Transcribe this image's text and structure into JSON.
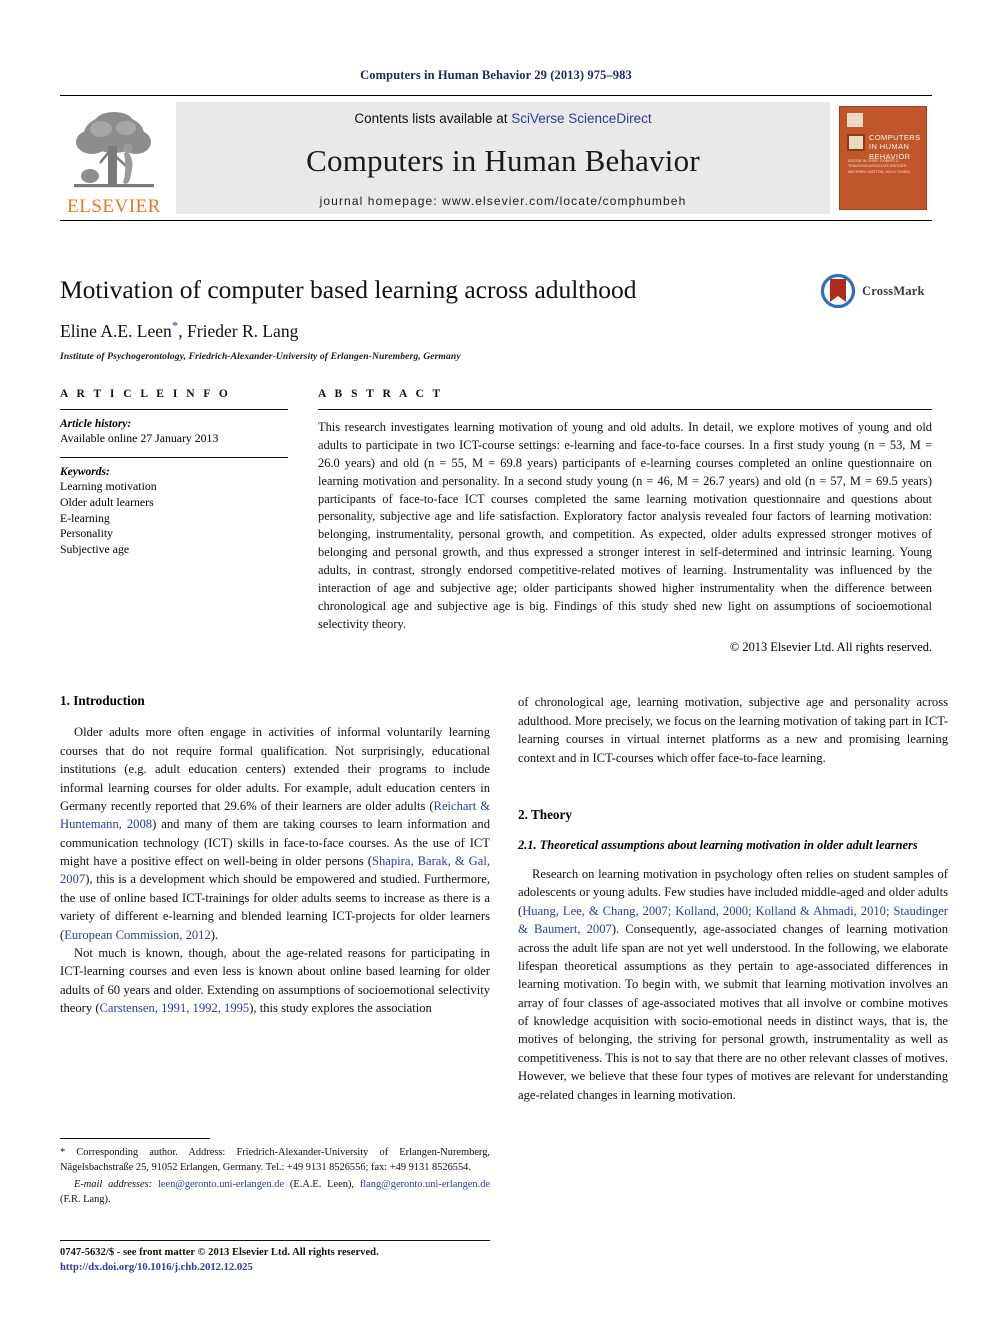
{
  "running_head": "Computers in Human Behavior 29 (2013) 975–983",
  "banner": {
    "contents_prefix": "Contents lists available at ",
    "contents_link": "SciVerse ScienceDirect",
    "journal_title": "Computers in Human Behavior",
    "homepage": "journal homepage: www.elsevier.com/locate/comphumbeh",
    "publisher_wordmark": "ELSEVIER",
    "cover_title": "COMPUTERS IN HUMAN BEHAVIOR",
    "cover_subtitle": "EDITOR-IN-CHIEF: ROBERT D. TENNYSON   ASSOCIATE EDITORS   MATTHIEU GUITTON, HOLLY O'NEILL"
  },
  "title": "Motivation of computer based learning across adulthood",
  "authors": "Eline A.E. Leen",
  "authors_rest": ", Frieder R. Lang",
  "corresponding_marker": "*",
  "affiliation": "Institute of Psychogerontology, Friedrich-Alexander-University of Erlangen-Nuremberg, Germany",
  "crossmark_label": "CrossMark",
  "article_info": {
    "heading": "A R T I C L E   I N F O",
    "history_heading": "Article history:",
    "history_line": "Available online 27 January 2013",
    "keywords_heading": "Keywords:",
    "keywords": [
      "Learning motivation",
      "Older adult learners",
      "E-learning",
      "Personality",
      "Subjective age"
    ]
  },
  "abstract": {
    "heading": "A B S T R A C T",
    "text": "This research investigates learning motivation of young and old adults. In detail, we explore motives of young and old adults to participate in two ICT-course settings: e-learning and face-to-face courses. In a first study young (n = 53, M = 26.0 years) and old (n = 55, M = 69.8 years) participants of e-learning courses completed an online questionnaire on learning motivation and personality. In a second study young (n = 46, M = 26.7 years) and old (n = 57, M = 69.5 years) participants of face-to-face ICT courses completed the same learning motivation questionnaire and questions about personality, subjective age and life satisfaction. Exploratory factor analysis revealed four factors of learning motivation: belonging, instrumentality, personal growth, and competition. As expected, older adults expressed stronger motives of belonging and personal growth, and thus expressed a stronger interest in self-determined and intrinsic learning. Young adults, in contrast, strongly endorsed competitive-related motives of learning. Instrumentality was influenced by the interaction of age and subjective age; older participants showed higher instrumentality when the difference between chronological age and subjective age is big. Findings of this study shed new light on assumptions of socioemotional selectivity theory.",
    "copyright": "© 2013 Elsevier Ltd. All rights reserved."
  },
  "sections": {
    "intro_heading": "1. Introduction",
    "intro_p1_a": "Older adults more often engage in activities of informal voluntarily learning courses that do not require formal qualification. Not surprisingly, educational institutions (e.g. adult education centers) extended their programs to include informal learning courses for older adults. For example, adult education centers in Germany recently reported that 29.6% of their learners are older adults (",
    "intro_p1_cit1": "Reichart & Huntemann, 2008",
    "intro_p1_b": ") and many of them are taking courses to learn information and communication technology (ICT) skills in face-to-face courses. As the use of ICT might have a positive effect on well-being in older persons (",
    "intro_p1_cit2": "Shapira, Barak, & Gal, 2007",
    "intro_p1_c": "), this is a development which should be empowered and studied. Furthermore, the use of online based ICT-trainings for older adults seems to increase as there is a variety of different e-learning and blended learning ICT-projects for older learners (",
    "intro_p1_cit3": "European Commission, 2012",
    "intro_p1_d": ").",
    "intro_p2_a": "Not much is known, though, about the age-related reasons for participating in ICT-learning courses and even less is known about online based learning for older adults of 60 years and older. Extending on assumptions of socioemotional selectivity theory (",
    "intro_p2_cit1": "Carstensen, 1991, 1992, 1995",
    "intro_p2_b": "), this study explores the association of chronological age, learning motivation, subjective age and personality across adulthood. More precisely, we focus on the learning motivation of taking part in ICT-learning courses in virtual internet platforms as a new and promising learning context and in ICT-courses which offer face-to-face learning.",
    "theory_heading": "2. Theory",
    "theory_sub_heading": "2.1. Theoretical assumptions about learning motivation in older adult learners",
    "theory_p1_a": "Research on learning motivation in psychology often relies on student samples of adolescents or young adults. Few studies have included middle-aged and older adults (",
    "theory_p1_cit": "Huang, Lee, & Chang, 2007; Kolland, 2000; Kolland & Ahmadi, 2010; Staudinger & Baumert, 2007",
    "theory_p1_b": "). Consequently, age-associated changes of learning motivation across the adult life span are not yet well understood. In the following, we elaborate lifespan theoretical assumptions as they pertain to age-associated differences in learning motivation. To begin with, we submit that learning motivation involves an array of four classes of age-associated motives that all involve or combine motives of knowledge acquisition with socio-emotional needs in distinct ways, that is, the motives of belonging, the striving for personal growth, instrumentality as well as competitiveness. This is not to say that there are no other relevant classes of motives. However, we believe that these four types of motives are relevant for understanding age-related changes in learning motivation."
  },
  "footnote": {
    "marker": "*",
    "corresponding_text": "Corresponding author. Address: Friedrich-Alexander-University of Erlangen-Nuremberg, Nägelsbachstraße 25, 91052 Erlangen, Germany. Tel.: +49 9131 8526556; fax: +49 9131 8526554.",
    "email_label": "E-mail addresses:",
    "email1": "leen@geronto.uni-erlangen.de",
    "email1_owner": " (E.A.E. Leen), ",
    "email2": "flang@geronto.uni-erlangen.de",
    "email2_owner": " (F.R. Lang)."
  },
  "footer": {
    "issn_line": "0747-5632/$ - see front matter © 2013 Elsevier Ltd. All rights reserved.",
    "doi": "http://dx.doi.org/10.1016/j.chb.2012.12.025"
  },
  "colors": {
    "link": "#2a3d9e",
    "elsevier_orange": "#E87722",
    "cover_bg": "#c0562a",
    "banner_bg": "#e9e9e9"
  }
}
